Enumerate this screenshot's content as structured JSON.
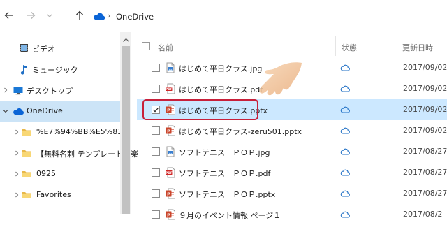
{
  "address_bar": {
    "location": "OneDrive",
    "separator": "›"
  },
  "navigation": [
    {
      "label": "ビデオ",
      "icon": "video-folder-icon",
      "indent": 1,
      "chevron": false
    },
    {
      "label": "ミュージック",
      "icon": "music-note-icon",
      "indent": 1,
      "chevron": false
    },
    {
      "label": "デスクトップ",
      "icon": "desktop-icon",
      "indent": 0,
      "chevron": true
    },
    {
      "label": "OneDrive",
      "icon": "onedrive-cloud-icon",
      "indent": 0,
      "chevron": true,
      "selected": true,
      "expanded": true
    },
    {
      "label": "%E7%94%BB%E5%83%",
      "icon": "folder-icon",
      "indent": 1,
      "chevron": true
    },
    {
      "label": "【無料名刺 テンプレート】楽",
      "icon": "folder-icon",
      "indent": 1,
      "chevron": true
    },
    {
      "label": "0925",
      "icon": "folder-icon",
      "indent": 1,
      "chevron": true
    },
    {
      "label": "Favorites",
      "icon": "folder-icon",
      "indent": 1,
      "chevron": true
    }
  ],
  "columns": {
    "name": "名前",
    "status": "状態",
    "modified": "更新日時"
  },
  "files": [
    {
      "name": "はじめて平日クラス.jpg",
      "type": "jpg",
      "date": "2017/09/02"
    },
    {
      "name": "はじめて平日クラス.pdf",
      "type": "pdf",
      "date": "2017/09/02"
    },
    {
      "name": "はじめて平日クラス.pptx",
      "type": "pptx",
      "date": "2017/09/02",
      "selected": true,
      "checked": true
    },
    {
      "name": "はじめて平日クラス-zeru501.pptx",
      "type": "pptx",
      "date": "2017/09/02"
    },
    {
      "name": "ソフトテニス　ＰＯＰ.jpg",
      "type": "jpg",
      "date": "2017/08/27"
    },
    {
      "name": "ソフトテニス　ＰＯＰ.pdf",
      "type": "pdf",
      "date": "2017/08/27"
    },
    {
      "name": "ソフトテニス　ＰＯＰ.pptx",
      "type": "pptx",
      "date": "2017/08/27"
    },
    {
      "name": "９月のイベント情報 ページ１",
      "type": "pptx",
      "date": "2017/08/2"
    }
  ],
  "colors": {
    "selection": "#cce8ff",
    "nav_selection": "#cce4f7",
    "highlight_outline": "#c8203a",
    "onedrive_blue": "#0a64d6"
  }
}
